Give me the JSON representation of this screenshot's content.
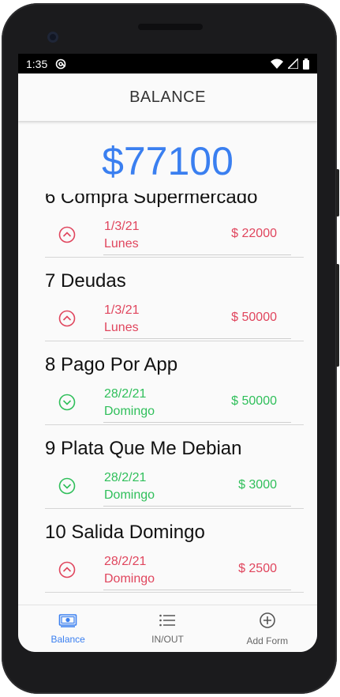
{
  "status_bar": {
    "time": "1:35"
  },
  "app_bar": {
    "title": "BALANCE"
  },
  "balance": {
    "amount": "$77100",
    "color": "#3a7ff0"
  },
  "transactions": [
    {
      "name": "6 Compra Supermercado",
      "date": "1/3/21",
      "weekday": "Lunes",
      "amount": "$ 22000",
      "type": "out",
      "icon": "chevron-up-circle-icon"
    },
    {
      "name": "7 Deudas",
      "date": "1/3/21",
      "weekday": "Lunes",
      "amount": "$ 50000",
      "type": "out",
      "icon": "chevron-up-circle-icon"
    },
    {
      "name": "8 Pago Por App",
      "date": "28/2/21",
      "weekday": "Domingo",
      "amount": "$ 50000",
      "type": "in",
      "icon": "chevron-down-circle-icon"
    },
    {
      "name": "9 Plata Que Me Debian",
      "date": "28/2/21",
      "weekday": "Domingo",
      "amount": "$ 3000",
      "type": "in",
      "icon": "chevron-down-circle-icon"
    },
    {
      "name": "10 Salida Domingo",
      "date": "28/2/21",
      "weekday": "Domingo",
      "amount": "$ 2500",
      "type": "out",
      "icon": "chevron-up-circle-icon"
    }
  ],
  "colors": {
    "out": "#e0455d",
    "in": "#2fbf5a",
    "accent": "#3a7ff0"
  },
  "bottom_nav": [
    {
      "label": "Balance",
      "icon": "money-icon",
      "active": true
    },
    {
      "label": "IN/OUT",
      "icon": "list-icon",
      "active": false
    },
    {
      "label": "Add Form",
      "icon": "add-circle-icon",
      "active": false
    }
  ]
}
